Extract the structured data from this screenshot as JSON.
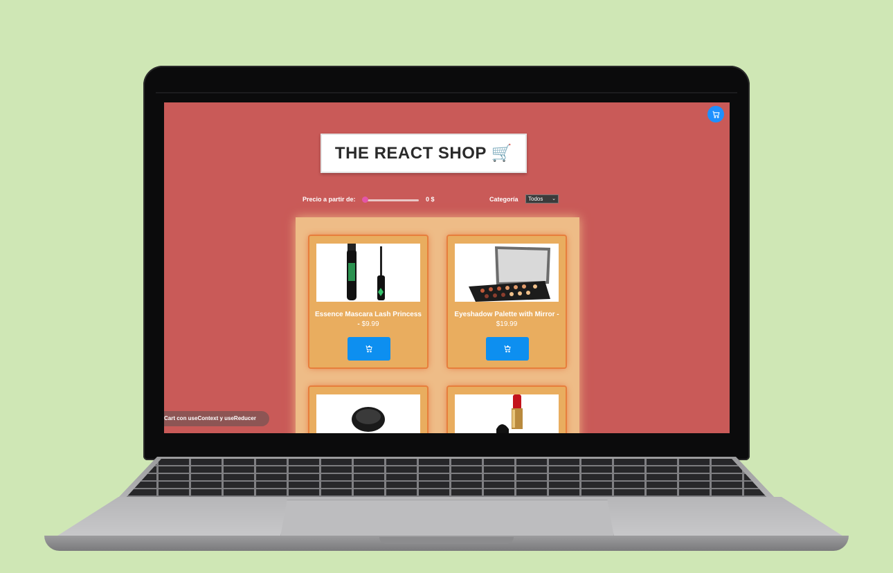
{
  "app": {
    "title": "THE REACT SHOP 🛒",
    "cart_icon": "cart-icon"
  },
  "filters": {
    "price_label": "Precio a partir de:",
    "price_value": "0 $",
    "price_slider_fraction": 0,
    "category_label": "Categoría",
    "category_selected": "Todos"
  },
  "products": [
    {
      "name": "Essence Mascara Lash Princess",
      "price": "$9.99",
      "image": "mascara-image"
    },
    {
      "name": "Eyeshadow Palette with Mirror",
      "price": "$19.99",
      "image": "eyeshadow-palette-image"
    },
    {
      "name": "",
      "price": "",
      "image": "powder-compact-image"
    },
    {
      "name": "",
      "price": "",
      "image": "red-lipstick-image"
    }
  ],
  "footer": {
    "label": "Cart con useContext y useReducer"
  },
  "colors": {
    "page_bg": "#cfe7b5",
    "screen_bg": "#c95a58",
    "panel_bg": "#eebc87",
    "card_bg": "#e9ad5f",
    "button_blue": "#0d8ff0"
  }
}
